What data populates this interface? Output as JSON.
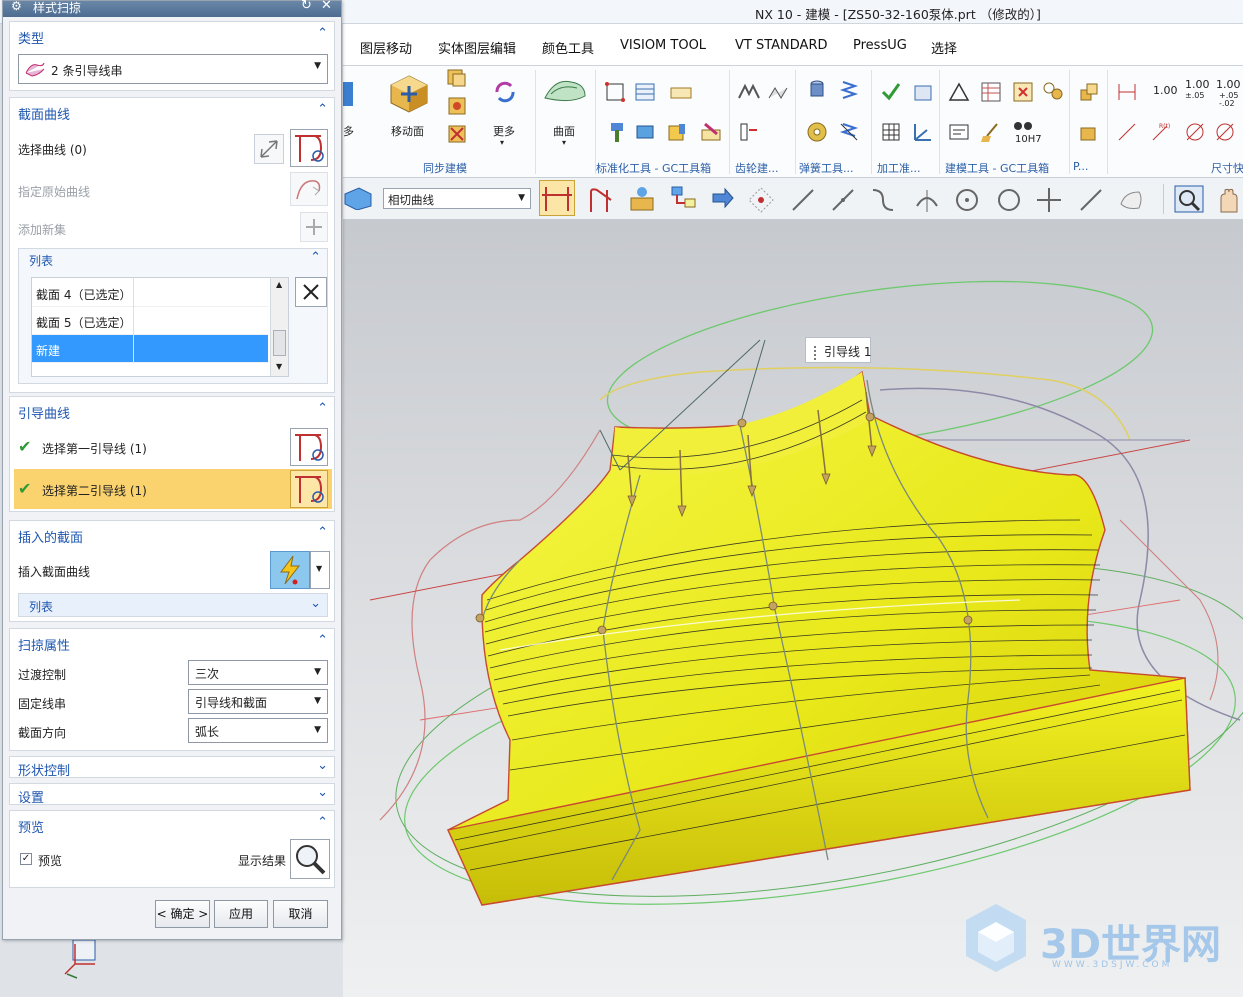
{
  "window": {
    "title": "NX 10 - 建模 - [ZS50-32-160泵体.prt （修改的）]"
  },
  "menu": {
    "items": [
      "图层移动",
      "实体图层编辑",
      "颜色工具",
      "VISIOM TOOL",
      "VT STANDARD",
      "PressUG",
      "选择"
    ]
  },
  "ribbon": {
    "groups": [
      "同步建模",
      "标准化工具 - GC工具箱",
      "齿轮建...",
      "弹簧工具...",
      "加工准...",
      "建模工具 - GC工具箱",
      "P...",
      "尺寸快"
    ],
    "labels": {
      "move_face": "移动面",
      "more": "更多",
      "surface": "曲面",
      "more_left": "多"
    },
    "dims": [
      "1.00",
      "1.00",
      "±.05",
      "1.00",
      "+.05",
      "-.02"
    ],
    "tol_label": "10H7"
  },
  "toolbar2": {
    "select_value": "相切曲线"
  },
  "dialog": {
    "title": "样式扫掠",
    "type": {
      "header": "类型",
      "value": "2 条引导线串"
    },
    "section_curves": {
      "header": "截面曲线",
      "select_curve": "选择曲线 (0)",
      "specify_origin": "指定原始曲线",
      "add_new": "添加新集",
      "list": {
        "header": "列表",
        "rows": [
          "截面 4（已选定）",
          "截面 5（已选定）",
          "新建"
        ]
      }
    },
    "guide_curves": {
      "header": "引导曲线",
      "first": "选择第一引导线 (1)",
      "second": "选择第二引导线 (1)"
    },
    "insert_section": {
      "header": "插入的截面",
      "label": "插入截面曲线",
      "list_header": "列表"
    },
    "sweep_props": {
      "header": "扫掠属性",
      "rows": [
        {
          "label": "过渡控制",
          "value": "三次"
        },
        {
          "label": "固定线串",
          "value": "引导线和截面"
        },
        {
          "label": "截面方向",
          "value": "弧长"
        }
      ]
    },
    "shape_control": {
      "header": "形状控制"
    },
    "settings": {
      "header": "设置"
    },
    "preview": {
      "header": "预览",
      "checkbox_label": "预览",
      "show_result": "显示结果"
    },
    "buttons": {
      "ok": "< 确定 >",
      "apply": "应用",
      "cancel": "取消"
    }
  },
  "viewport": {
    "tooltip": "引导线 1"
  },
  "watermark": {
    "text": "3D世界网",
    "url": "WWW.3DSJW.COM"
  },
  "colors": {
    "accent": "#1f57b0",
    "selection": "#3399ff",
    "highlight_row": "#fad36f",
    "model": "#f2f20a"
  }
}
